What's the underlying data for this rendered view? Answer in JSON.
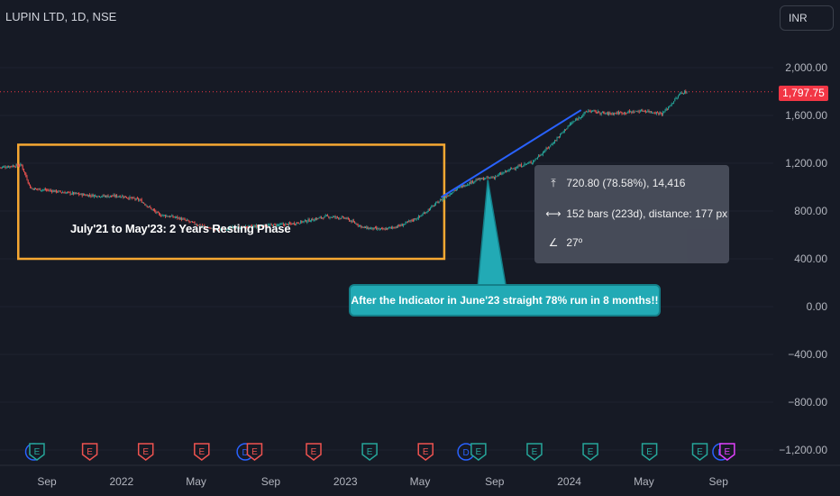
{
  "header": {
    "symbol": "LUPIN LTD, 1D, NSE",
    "currency": "INR"
  },
  "price_tag": {
    "value": "1,797.75",
    "color": "#f23645"
  },
  "annotations": {
    "rest_phase": "July'21 to May'23: 2 Years Resting Phase",
    "callout": "After the Indicator in June'23 straight 78% run in 8 months!!",
    "measure": {
      "price_change": "720.80 (78.58%), 14,416",
      "bars": "152 bars (223d), distance: 177 px",
      "angle": "27º"
    }
  },
  "icons": {
    "measure_price": "vertical-range-icon",
    "measure_bars": "horizontal-range-icon",
    "measure_angle": "angle-icon"
  },
  "colors": {
    "up": "#26a69a",
    "down": "#ef5350",
    "trendline": "#2962ff",
    "box": "#f7a832",
    "earnings": "#ef5350",
    "dividend": "#2962ff"
  },
  "chart_data": {
    "type": "candlestick",
    "y_ticks": [
      "2,000.00",
      "1,600.00",
      "1,200.00",
      "800.00",
      "400.00",
      "0.00",
      "−400.00",
      "−800.00",
      "−1,200.00"
    ],
    "y_tick_values": [
      2000,
      1600,
      1200,
      800,
      400,
      0,
      -400,
      -800,
      -1200
    ],
    "x_ticks": [
      "Sep",
      "2022",
      "May",
      "Sep",
      "2023",
      "May",
      "Sep",
      "2024",
      "May",
      "Sep"
    ],
    "x_tick_dates": [
      "2021-09",
      "2022-01",
      "2022-05",
      "2022-09",
      "2023-01",
      "2023-05",
      "2023-09",
      "2024-01",
      "2024-05",
      "2024-09"
    ],
    "ylim": [
      -1300,
      2220
    ],
    "last_price": 1797.75,
    "price_path": [
      [
        "2021-06-15",
        1165
      ],
      [
        "2021-07-01",
        1175
      ],
      [
        "2021-07-20",
        1185
      ],
      [
        "2021-08-05",
        990
      ],
      [
        "2021-09-01",
        975
      ],
      [
        "2021-10-01",
        955
      ],
      [
        "2021-11-01",
        935
      ],
      [
        "2021-12-01",
        925
      ],
      [
        "2022-01-01",
        925
      ],
      [
        "2022-02-01",
        890
      ],
      [
        "2022-03-01",
        770
      ],
      [
        "2022-04-01",
        745
      ],
      [
        "2022-05-01",
        690
      ],
      [
        "2022-06-01",
        645
      ],
      [
        "2022-07-01",
        660
      ],
      [
        "2022-08-01",
        670
      ],
      [
        "2022-09-01",
        680
      ],
      [
        "2022-10-01",
        690
      ],
      [
        "2022-11-01",
        720
      ],
      [
        "2022-12-01",
        755
      ],
      [
        "2023-01-01",
        740
      ],
      [
        "2023-02-01",
        660
      ],
      [
        "2023-03-01",
        645
      ],
      [
        "2023-04-01",
        680
      ],
      [
        "2023-05-01",
        755
      ],
      [
        "2023-06-01",
        880
      ],
      [
        "2023-07-01",
        990
      ],
      [
        "2023-08-01",
        1060
      ],
      [
        "2023-09-01",
        1085
      ],
      [
        "2023-10-01",
        1160
      ],
      [
        "2023-11-01",
        1210
      ],
      [
        "2023-12-01",
        1350
      ],
      [
        "2024-01-01",
        1520
      ],
      [
        "2024-02-01",
        1640
      ],
      [
        "2024-03-01",
        1615
      ],
      [
        "2024-04-01",
        1625
      ],
      [
        "2024-05-01",
        1640
      ],
      [
        "2024-06-01",
        1615
      ],
      [
        "2024-07-01",
        1790
      ],
      [
        "2024-07-10",
        1798
      ]
    ],
    "trendline": {
      "start": [
        "2023-06-05",
        915
      ],
      "end": [
        "2024-01-20",
        1645
      ]
    },
    "rest_box": {
      "from": "2021-07-15",
      "to": "2023-06-10",
      "low": 400,
      "high": 1355
    },
    "events": [
      {
        "type": "D",
        "date": "2021-08-10"
      },
      {
        "type": "E",
        "date": "2021-08-15"
      },
      {
        "type": "E",
        "date": "2021-11-10"
      },
      {
        "type": "E",
        "date": "2022-02-10"
      },
      {
        "type": "E",
        "date": "2022-05-10"
      },
      {
        "type": "D",
        "date": "2022-07-20"
      },
      {
        "type": "E",
        "date": "2022-08-05"
      },
      {
        "type": "E",
        "date": "2022-11-10"
      },
      {
        "type": "E",
        "date": "2023-02-10"
      },
      {
        "type": "E",
        "date": "2023-05-10"
      },
      {
        "type": "D",
        "date": "2023-07-15"
      },
      {
        "type": "E",
        "date": "2023-08-05"
      },
      {
        "type": "E",
        "date": "2023-11-05"
      },
      {
        "type": "E",
        "date": "2024-02-05"
      },
      {
        "type": "E",
        "date": "2024-05-10"
      },
      {
        "type": "E",
        "date": "2024-08-01"
      },
      {
        "type": "D",
        "date": "2024-09-05"
      },
      {
        "type": "E",
        "date": "2024-09-15"
      }
    ]
  }
}
